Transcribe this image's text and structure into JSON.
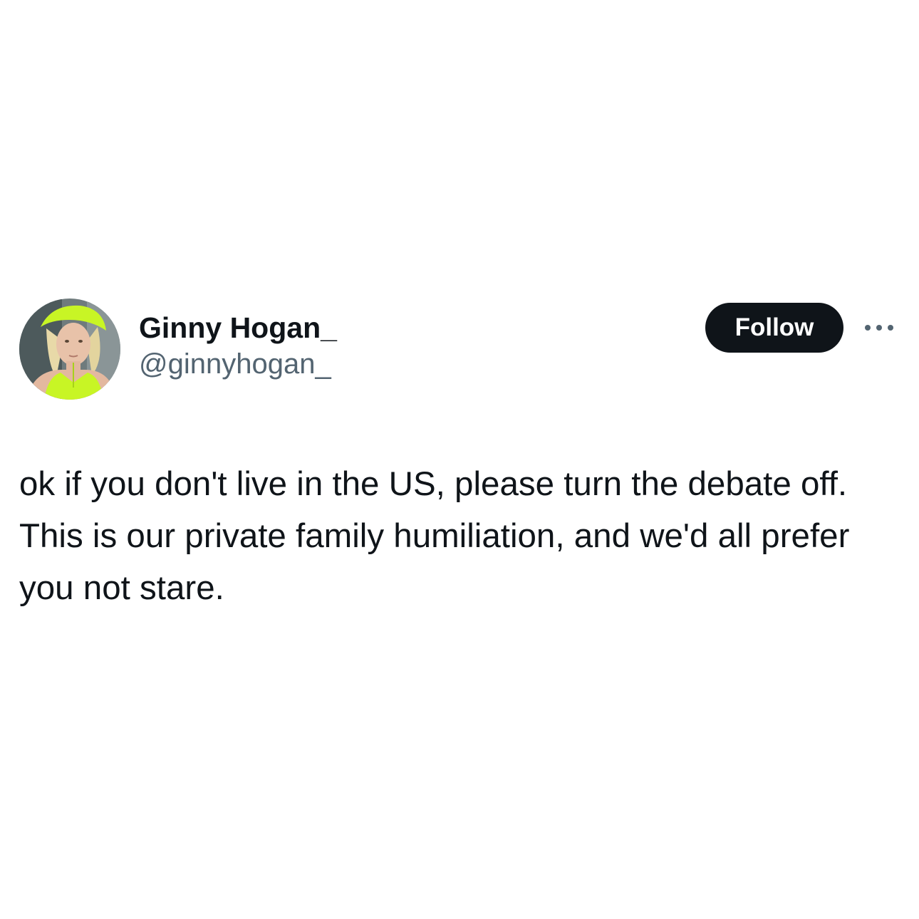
{
  "author": {
    "display_name": "Ginny Hogan_",
    "handle": "@ginnyhogan_",
    "avatar_icon": "profile-photo"
  },
  "actions": {
    "follow_label": "Follow",
    "more_icon": "ellipsis-icon"
  },
  "post": {
    "text": "ok if you don't live in the US, please turn the debate off. This is our private family humiliation, and we'd all prefer you not stare."
  },
  "colors": {
    "text_primary": "#0f1419",
    "text_secondary": "#536471",
    "follow_bg": "#0f1419",
    "follow_text": "#ffffff",
    "background": "#ffffff",
    "avatar_accent": "#c8f525"
  }
}
